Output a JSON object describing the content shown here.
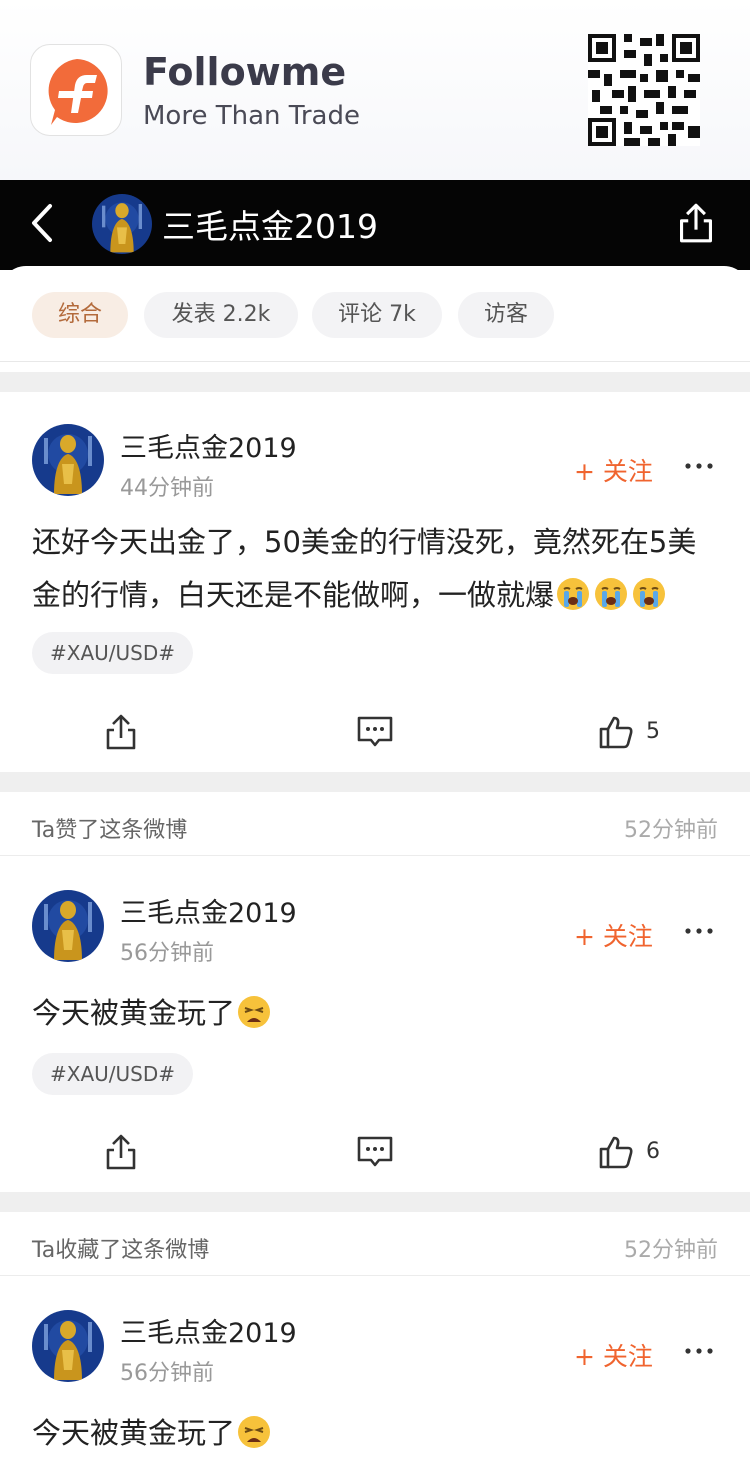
{
  "banner": {
    "app_name": "Followme",
    "slogan": "More Than Trade",
    "colors": {
      "brand": "#f26b3a"
    }
  },
  "header": {
    "title": "三毛点金2019",
    "back_icon": "chevron-left-icon",
    "share_icon": "share-icon"
  },
  "tabs": [
    {
      "label": "综合",
      "active": true
    },
    {
      "label": "发表 2.2k",
      "active": false
    },
    {
      "label": "评论 7k",
      "active": false
    },
    {
      "label": "访客",
      "active": false
    }
  ],
  "posts": [
    {
      "author": "三毛点金2019",
      "time": "44分钟前",
      "follow_label": "+ 关注",
      "content_line1": "还好今天出金了，50美金的行情没死，竟然死在5美",
      "content_line2": "金的行情，白天还是不能做啊，一做就爆",
      "emoji": [
        "crying-face-icon",
        "crying-face-icon",
        "crying-face-icon"
      ],
      "tag": "#XAU/USD#",
      "likes": "5"
    },
    {
      "activity": "Ta赞了这条微博",
      "activity_time": "52分钟前",
      "author": "三毛点金2019",
      "time": "56分钟前",
      "follow_label": "+ 关注",
      "content": "今天被黄金玩了",
      "emoji": [
        "weary-face-icon"
      ],
      "tag": "#XAU/USD#",
      "likes": "6"
    },
    {
      "activity": "Ta收藏了这条微博",
      "activity_time": "52分钟前",
      "author": "三毛点金2019",
      "time": "56分钟前",
      "follow_label": "+ 关注",
      "content": "今天被黄金玩了",
      "emoji": [
        "weary-face-icon"
      ]
    }
  ]
}
